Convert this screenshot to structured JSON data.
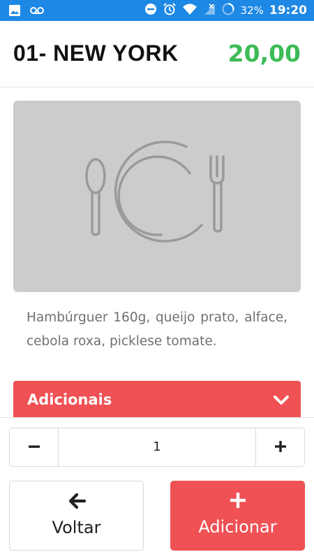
{
  "status_bar": {
    "battery": "32%",
    "time": "19:20",
    "icons": [
      "image-icon",
      "voicemail-icon",
      "dnd-icon",
      "alarm-icon",
      "wifi-icon",
      "signal-icon",
      "battery-icon"
    ]
  },
  "header": {
    "title": "01- NEW YORK",
    "price": "20,00",
    "price_color": "#3dbb57"
  },
  "product": {
    "image_icon": "plate-cutlery-icon",
    "description": "Hambúrguer 160g, queijo prato, alface, cebola roxa, picklese tomate."
  },
  "adicionais": {
    "label": "Adicionais",
    "icon": "chevron-down-icon",
    "color": "#ef5154"
  },
  "quantity": {
    "value": "1",
    "minus_icon": "minus-icon",
    "plus_icon": "plus-icon"
  },
  "actions": {
    "back_label": "Voltar",
    "back_icon": "arrow-left-icon",
    "add_label": "Adicionar",
    "add_icon": "plus-icon"
  }
}
